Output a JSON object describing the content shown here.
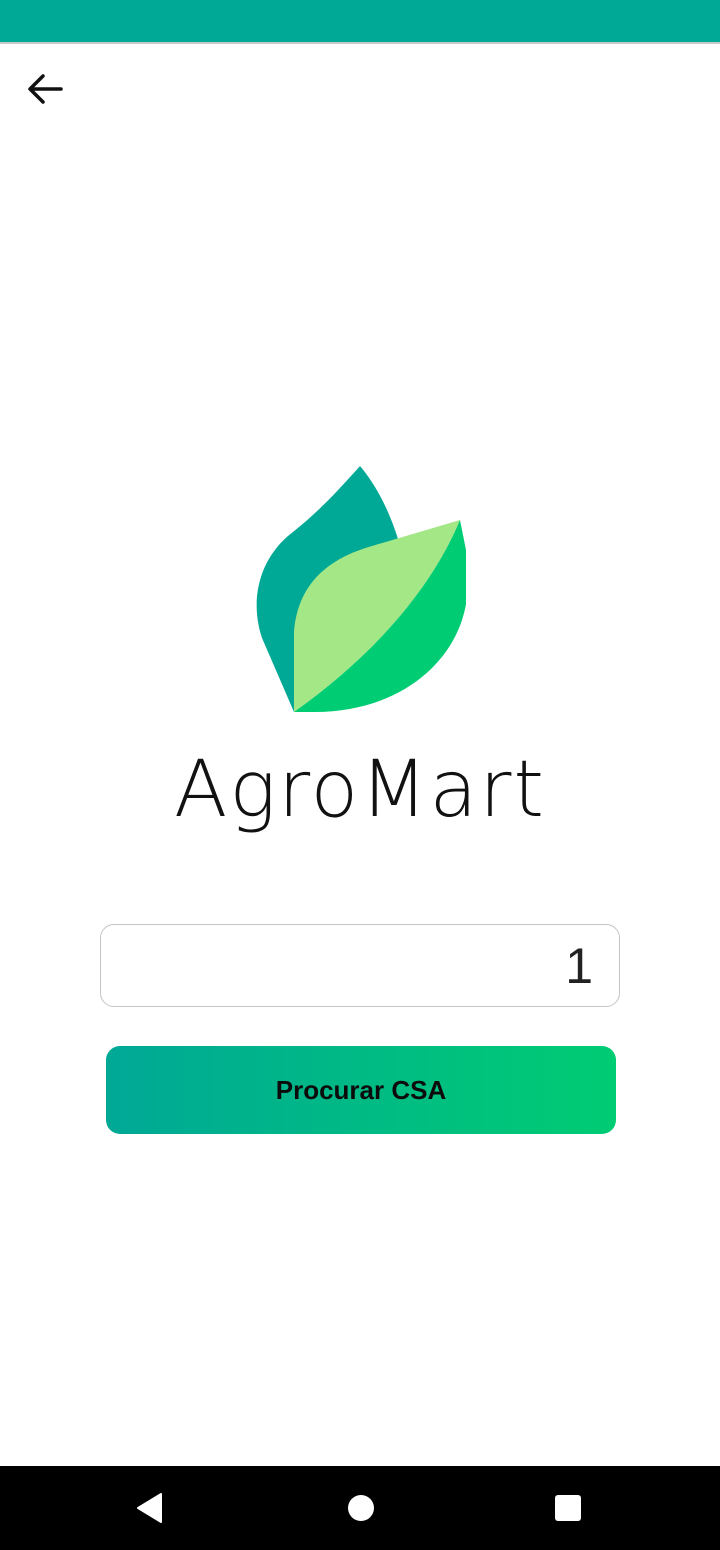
{
  "app": {
    "name": "AgroMart"
  },
  "colors": {
    "status_bar": "#00a896",
    "leaf_dark": "#00a896",
    "leaf_light": "#a4e786",
    "leaf_green": "#00cc73",
    "button_gradient_start": "#00a896",
    "button_gradient_end": "#00cc73"
  },
  "header": {
    "back_icon": "arrow-left-icon"
  },
  "form": {
    "input_value": "1",
    "search_button_label": "Procurar CSA"
  },
  "system_nav": {
    "back_icon": "triangle-back-icon",
    "home_icon": "circle-home-icon",
    "recents_icon": "square-recents-icon"
  }
}
